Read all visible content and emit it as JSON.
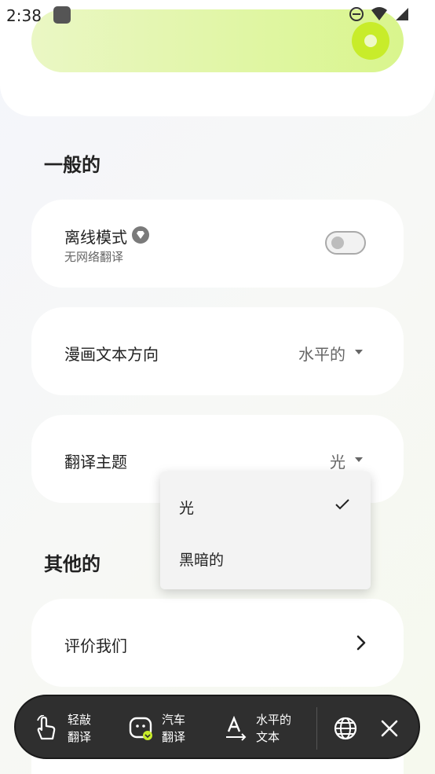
{
  "status_bar": {
    "time": "2:38"
  },
  "sections": {
    "general_title": "一般的",
    "other_title": "其他的"
  },
  "settings": {
    "offline_mode": {
      "label": "离线模式",
      "sublabel": "无网络翻译",
      "enabled": false
    },
    "comic_text_direction": {
      "label": "漫画文本方向",
      "value": "水平的"
    },
    "translation_theme": {
      "label": "翻译主题",
      "value": "光"
    },
    "rate_us": {
      "label": "评价我们"
    }
  },
  "theme_dropdown": {
    "options": [
      {
        "label": "光",
        "selected": true
      },
      {
        "label": "黑暗的",
        "selected": false
      }
    ]
  },
  "toolbar": {
    "tap_translate": {
      "line1": "轻敲",
      "line2": "翻译"
    },
    "auto_translate": {
      "line1": "汽车",
      "line2": "翻译"
    },
    "horizontal_text": {
      "line1": "水平的",
      "line2": "文本"
    }
  },
  "colors": {
    "accent_lime": "#c8ec2a",
    "toolbar_bg": "#2f2f2f",
    "card_bg": "#ffffff"
  }
}
